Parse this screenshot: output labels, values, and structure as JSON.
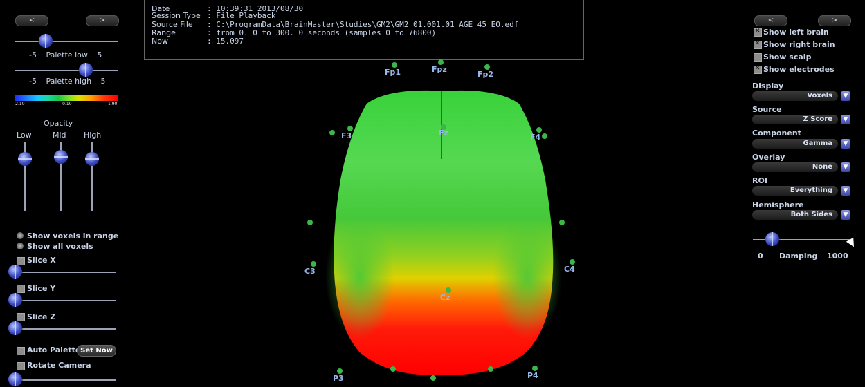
{
  "left_panel": {
    "prev": "<",
    "next": ">",
    "palette_low": {
      "min": "-5",
      "label": "Palette low",
      "max": "5"
    },
    "palette_high": {
      "min": "-5",
      "label": "Palette high",
      "max": "5"
    },
    "palette_scale": [
      "-2.10",
      "-0.10",
      "1.90"
    ],
    "opacity": {
      "title": "Opacity",
      "low": "Low",
      "mid": "Mid",
      "high": "High"
    },
    "show_voxels_range": "Show voxels in range",
    "show_all_voxels": "Show all voxels",
    "slice_x": "Slice X",
    "slice_y": "Slice Y",
    "slice_z": "Slice Z",
    "auto_palette": "Auto Palette",
    "set_now": "Set Now",
    "rotate_camera": "Rotate Camera"
  },
  "info": {
    "date_key": "Date",
    "date_val": ": 10:39:31 2013/08/30",
    "session_key": "Session Type",
    "session_val": ": File Playback",
    "source_key": "Source File",
    "source_val": ": C:\\ProgramData\\BrainMaster\\Studies\\GM2\\GM2 01.001.01 AGE 45  EO.edf",
    "range_key": "Range",
    "range_val": ": from 0.  0 to 300.  0 seconds (samples 0 to 76800)",
    "now_key": "Now",
    "now_val": ": 15.097"
  },
  "electrodes": {
    "fp1": "Fp1",
    "fpz": "Fpz",
    "fp2": "Fp2",
    "f3": "F3",
    "fz": "Fz",
    "f4": "F4",
    "c3": "C3",
    "cz": "Cz",
    "c4": "C4",
    "p3": "P3",
    "p4": "P4"
  },
  "right_panel": {
    "prev": "<",
    "next": ">",
    "show_left_brain": "Show left brain",
    "show_right_brain": "Show right brain",
    "show_scalp": "Show scalp",
    "show_electrodes": "Show electrodes",
    "display_label": "Display",
    "display_value": "Voxels",
    "source_label": "Source",
    "source_value": "Z Score",
    "component_label": "Component",
    "component_value": "Gamma",
    "overlay_label": "Overlay",
    "overlay_value": "None",
    "roi_label": "ROI",
    "roi_value": "Everything",
    "hemisphere_label": "Hemisphere",
    "hemisphere_value": "Both Sides",
    "damping_min": "0",
    "damping_label": "Damping",
    "damping_max": "1000"
  }
}
